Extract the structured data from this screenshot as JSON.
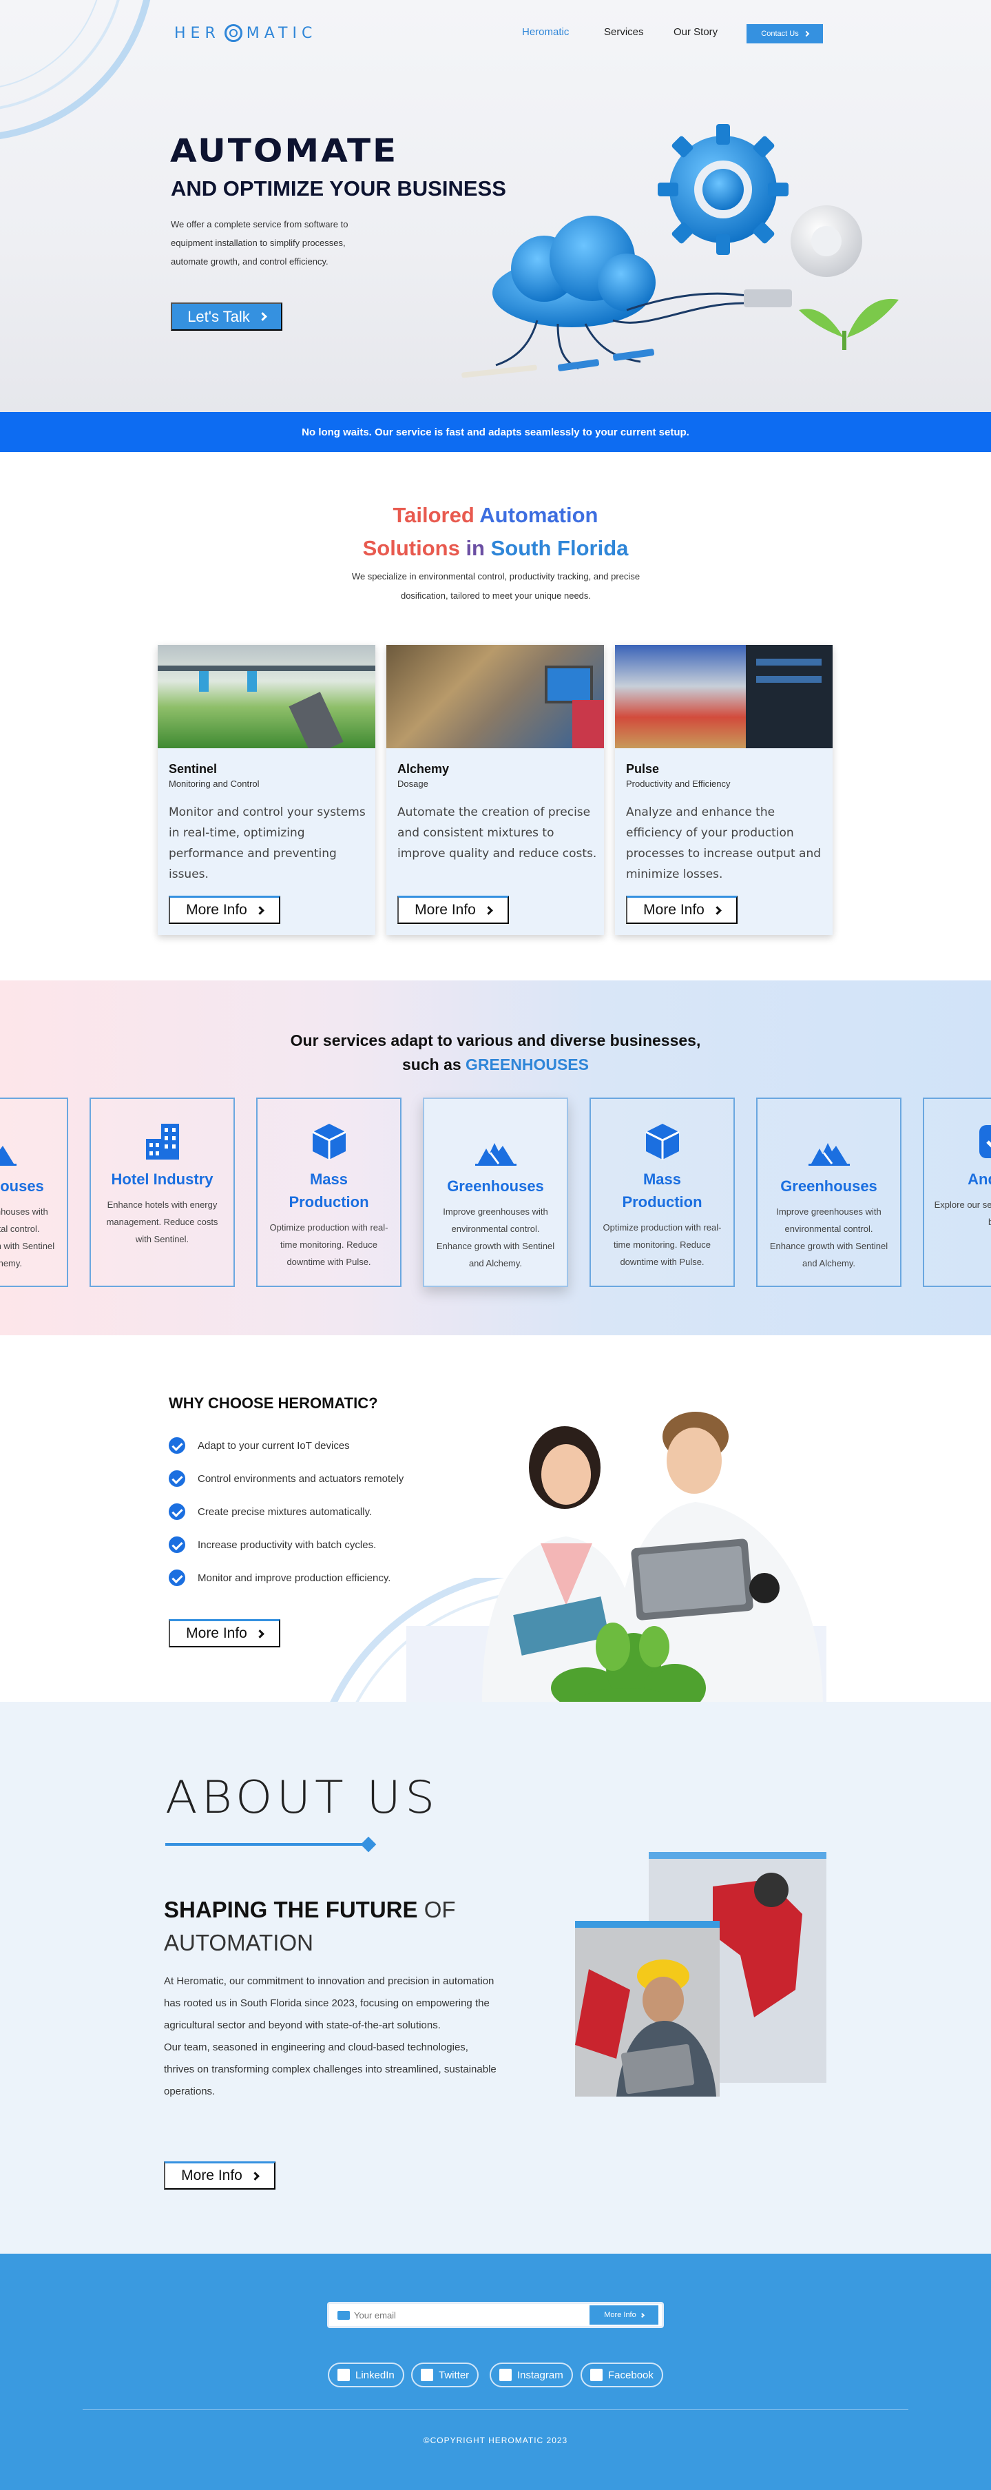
{
  "header": {
    "logo_text_left": "HER",
    "logo_text_right": "MATIC",
    "nav": [
      "Heromatic",
      "Services",
      "Our Story"
    ],
    "contact_label": "Contact Us"
  },
  "hero": {
    "title": "AUTOMATE",
    "subtitle": "AND OPTIMIZE YOUR BUSINESS",
    "description": "We offer a complete service from software to equipment installation to simplify processes, automate growth, and control efficiency.",
    "cta": "Let's Talk"
  },
  "banner": {
    "text": "No long waits. Our service is fast and adapts seamlessly to your current setup."
  },
  "tailored": {
    "title_1a": "Tailored",
    "title_1b": "Automation",
    "title_2a": "Solutions",
    "title_2b": "in",
    "title_2c": "South Florida",
    "description": "We specialize in environmental control, productivity tracking, and precise dosification, tailored to meet your unique needs.",
    "cards": [
      {
        "title": "Sentinel",
        "subtitle": "Monitoring and Control",
        "text": "Monitor and control your systems in real-time, optimizing performance and preventing issues.",
        "button": "More Info"
      },
      {
        "title": "Alchemy",
        "subtitle": "Dosage",
        "text": "Automate the creation of precise and consistent mixtures to improve quality and reduce costs.",
        "button": "More Info"
      },
      {
        "title": "Pulse",
        "subtitle": "Productivity and Efficiency",
        "text": "Analyze and enhance the efficiency of your production processes to increase output and minimize losses.",
        "button": "More Info"
      }
    ]
  },
  "services": {
    "title_line1": "Our services adapt to various and diverse businesses,",
    "title_line2a": "such as",
    "title_line2b": "GREENHOUSES",
    "cards": [
      {
        "name": "Greenhouses",
        "desc": "Improve greenhouses with environmental control. Enhance growth with Sentinel and Alchemy.",
        "icon": "trees-icon"
      },
      {
        "name": "Hotel Industry",
        "desc": "Enhance hotels with energy management. Reduce costs with Sentinel.",
        "icon": "hotel-icon"
      },
      {
        "name": "Mass Production",
        "desc": "Optimize production with real-time monitoring. Reduce downtime with Pulse.",
        "icon": "cube-icon"
      },
      {
        "name": "Greenhouses",
        "desc": "Improve greenhouses with environmental control. Enhance growth with Sentinel and Alchemy.",
        "icon": "trees-icon"
      },
      {
        "name": "Mass Production",
        "desc": "Optimize production with real-time monitoring. Reduce downtime with Pulse.",
        "icon": "cube-icon"
      },
      {
        "name": "Greenhouses",
        "desc": "Improve greenhouses with environmental control. Enhance growth with Sentinel and Alchemy.",
        "icon": "trees-icon"
      },
      {
        "name": "And Mu",
        "desc": "Explore our services ta various bus",
        "icon": "check-icon"
      }
    ]
  },
  "why": {
    "title": "WHY CHOOSE HEROMATIC?",
    "items": [
      "Adapt to your current IoT devices",
      "Control environments and actuators remotely",
      "Create precise mixtures automatically.",
      "Increase productivity with batch cycles.",
      "Monitor and improve production efficiency."
    ],
    "button": "More Info"
  },
  "about": {
    "big_title": "ABOUT US",
    "shape_bold": "SHAPING THE FUTURE",
    "shape_rest": "OF AUTOMATION",
    "paragraph1": "At Heromatic, our commitment to innovation and precision in automation has rooted us in South Florida since 2023, focusing on empowering the agricultural sector and beyond with state-of-the-art solutions.",
    "paragraph2": "Our team, seasoned in engineering and cloud-based technologies, thrives on transforming complex challenges into streamlined, sustainable operations.",
    "button": "More Info"
  },
  "footer": {
    "email_placeholder": "Your email",
    "email_button": "More Info",
    "socials": [
      "LinkedIn",
      "Twitter",
      "Instagram",
      "Facebook"
    ],
    "copyright": "©COPYRIGHT  HEROMATIC 2023"
  },
  "colors": {
    "primary": "#3591e0",
    "banner": "#0d6cf2",
    "accent_red": "#e85a4f",
    "dark": "#0d1330"
  }
}
